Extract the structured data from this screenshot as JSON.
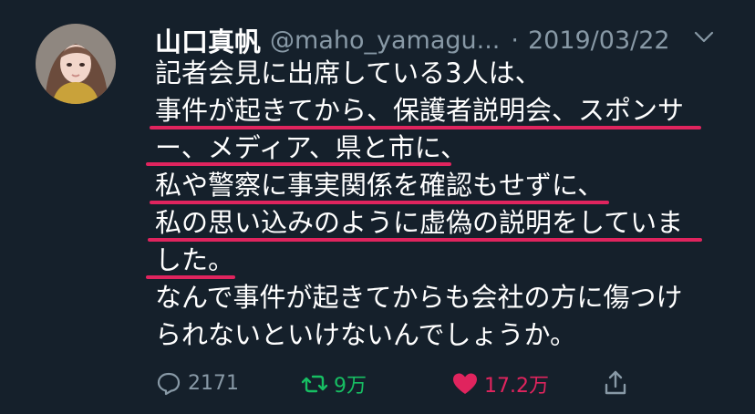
{
  "author": {
    "name": "山口真帆",
    "handle": "@maho_yamagu...",
    "separator": "·",
    "date": "2019/03/22"
  },
  "tweet": {
    "lines": [
      "記者会見に出席している3人は、",
      "事件が起きてから、保護者説明会、スポンサ",
      "ー、メディア、県と市に、",
      "私や警察に事実関係を確認もせずに、",
      "私の思い込みのように虚偽の説明をしていま",
      "した。",
      "なんで事件が起きてからも会社の方に傷つけ",
      "られないといけないんでしょうか。"
    ]
  },
  "actions": {
    "reply_count": "2171",
    "retweet_count": "9万",
    "like_count": "17.2万"
  },
  "colors": {
    "background": "#15202b",
    "muted": "#8899a6",
    "underline": "#e0245e",
    "retweet": "#17bf63",
    "like": "#e0245e"
  },
  "icons": [
    "chevron-down-icon",
    "reply-icon",
    "retweet-icon",
    "heart-icon",
    "share-icon"
  ]
}
